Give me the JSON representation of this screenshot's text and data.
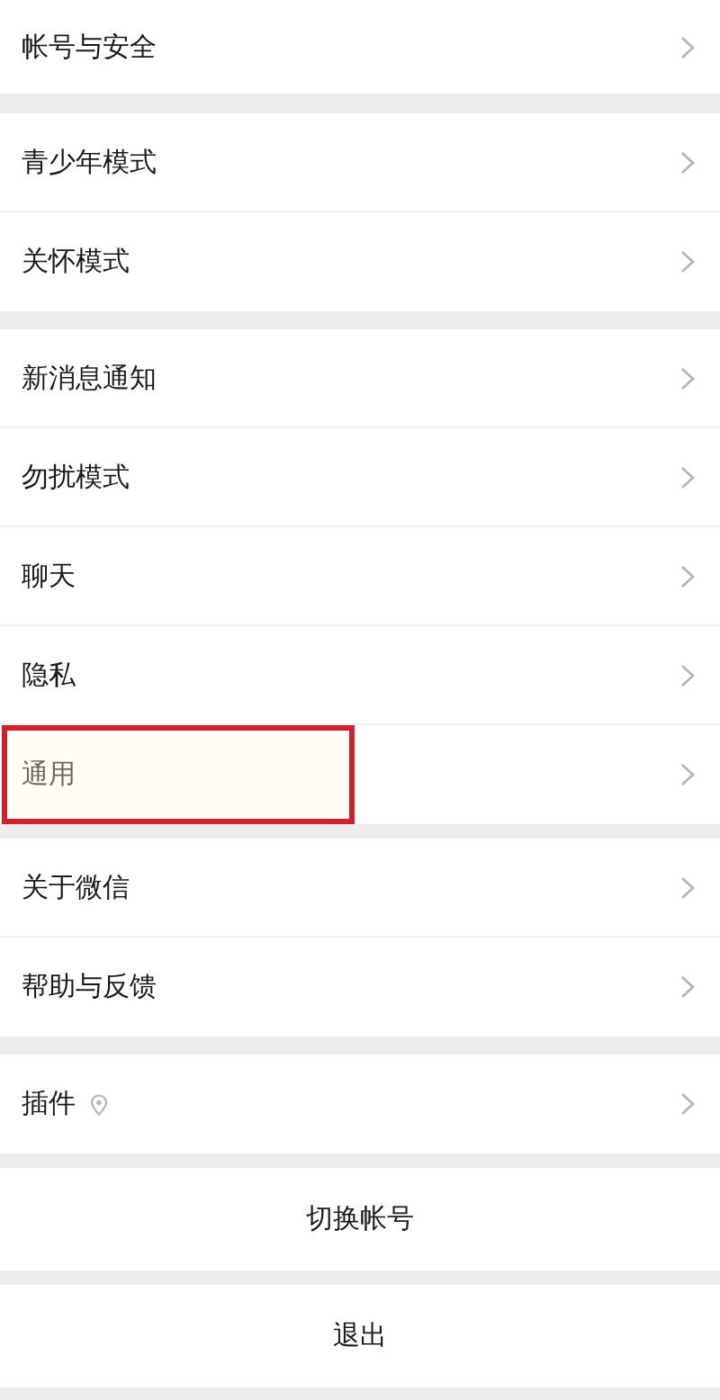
{
  "groups": [
    {
      "items": [
        {
          "label": "帐号与安全",
          "kind": "nav",
          "highlighted": false
        }
      ]
    },
    {
      "items": [
        {
          "label": "青少年模式",
          "kind": "nav",
          "highlighted": false
        },
        {
          "label": "关怀模式",
          "kind": "nav",
          "highlighted": false
        }
      ]
    },
    {
      "items": [
        {
          "label": "新消息通知",
          "kind": "nav",
          "highlighted": false
        },
        {
          "label": "勿扰模式",
          "kind": "nav",
          "highlighted": false
        },
        {
          "label": "聊天",
          "kind": "nav",
          "highlighted": false
        },
        {
          "label": "隐私",
          "kind": "nav",
          "highlighted": false
        },
        {
          "label": "通用",
          "kind": "nav",
          "highlighted": true
        }
      ]
    },
    {
      "items": [
        {
          "label": "关于微信",
          "kind": "nav",
          "highlighted": false
        },
        {
          "label": "帮助与反馈",
          "kind": "nav",
          "highlighted": false
        }
      ]
    },
    {
      "items": [
        {
          "label": "插件",
          "kind": "plugin",
          "highlighted": false
        }
      ]
    }
  ],
  "buttons": [
    {
      "label": "切换帐号"
    },
    {
      "label": "退出"
    }
  ]
}
